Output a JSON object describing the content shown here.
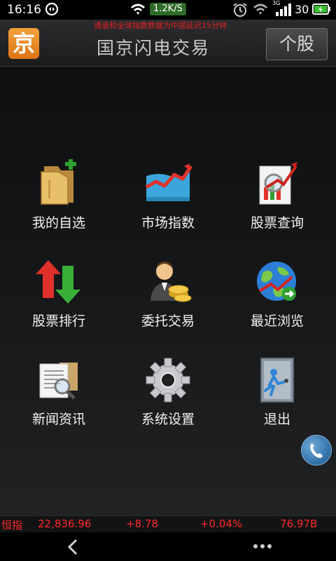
{
  "status_bar": {
    "time": "16:16",
    "net_speed": "1.2K/S",
    "network_type": "3G",
    "battery_level": "30",
    "icons": [
      "sync-icon",
      "wifi-icon",
      "alarm-icon",
      "wifi-icon",
      "signal-icon",
      "battery-icon"
    ]
  },
  "header": {
    "logo_text": "京",
    "title": "国京闪电交易",
    "right_button": "个股",
    "scrolling_message": "通道和全球指数数据为中国延迟15分钟"
  },
  "menu": {
    "items": [
      {
        "label": "我的自选",
        "icon": "folder-add-icon"
      },
      {
        "label": "市场指数",
        "icon": "trend-chart-icon"
      },
      {
        "label": "股票查询",
        "icon": "chart-search-icon"
      },
      {
        "label": "股票排行",
        "icon": "up-down-arrows-icon"
      },
      {
        "label": "委托交易",
        "icon": "trader-coins-icon"
      },
      {
        "label": "最近浏览",
        "icon": "globe-arrow-icon"
      },
      {
        "label": "新闻资讯",
        "icon": "news-search-icon"
      },
      {
        "label": "系统设置",
        "icon": "gear-icon"
      },
      {
        "label": "退出",
        "icon": "exit-door-icon"
      }
    ]
  },
  "index_ticker": {
    "name": "恒指",
    "value": "22,836.96",
    "change": "+8.78",
    "change_pct": "+0.04%",
    "volume": "76.97B",
    "color": "#ff2a2a"
  },
  "floating_button": {
    "icon": "phone-icon"
  },
  "nav_bar": {
    "icons": [
      "back-icon",
      "more-icon"
    ]
  },
  "colors": {
    "accent_orange": "#e8891f",
    "ticker_red": "#ff2a2a"
  }
}
